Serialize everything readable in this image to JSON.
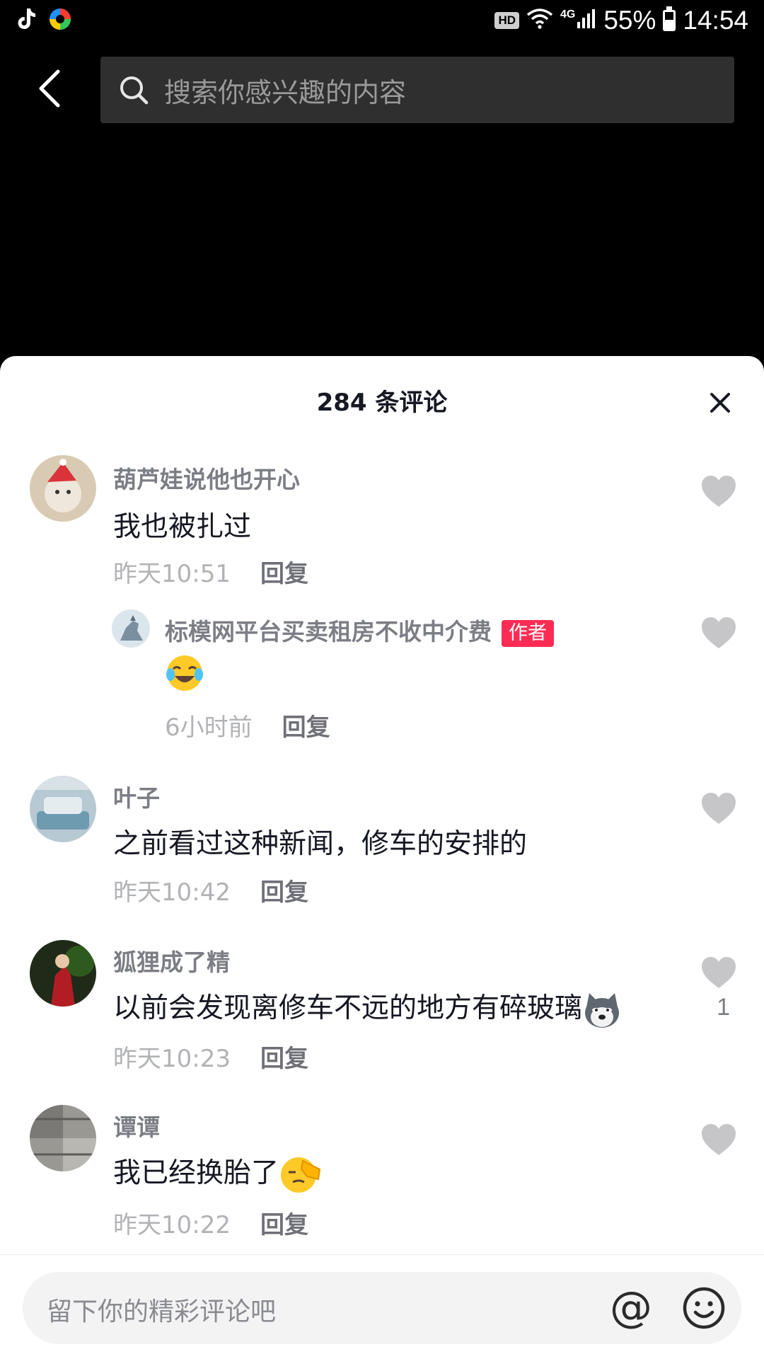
{
  "status_bar": {
    "hd": "HD",
    "network": "4G",
    "battery": "55%",
    "time": "14:54",
    "battery_level": 0.55
  },
  "search": {
    "placeholder": "搜索你感兴趣的内容"
  },
  "comments_panel": {
    "title": "284 条评论",
    "comments": [
      {
        "user": "葫芦娃说他也开心",
        "text": "我也被扎过",
        "time": "昨天10:51",
        "reply_label": "回复",
        "avatar_color": "#c9b79a"
      },
      {
        "user": "标模网平台买卖租房不收中介费",
        "badge": "作者",
        "text": "",
        "emoji": "laughing-crying-emoji",
        "time": "6小时前",
        "reply_label": "回复",
        "avatar_color": "#c7d4dc"
      },
      {
        "user": "叶子",
        "text": "之前看过这种新闻，修车的安排的",
        "time": "昨天10:42",
        "reply_label": "回复",
        "avatar_color": "#9bb6c5"
      },
      {
        "user": "狐狸成了精",
        "text": "以前会发现离修车不远的地方有碎玻璃",
        "emoji": "husky-emoji",
        "time": "昨天10:23",
        "reply_label": "回复",
        "likes": "1",
        "avatar_color": "#2a3a1f"
      },
      {
        "user": "谭谭",
        "text": "我已经换胎了",
        "emoji": "facepalm-emoji",
        "time": "昨天10:22",
        "reply_label": "回复",
        "avatar_color": "#8c8a86"
      }
    ]
  },
  "comment_input": {
    "placeholder": "留下你的精彩评论吧",
    "at_label": "@"
  },
  "colors": {
    "accent": "#fe2c55",
    "text_primary": "#161823",
    "text_secondary": "#7c7e86",
    "like_icon": "#c6c6c9"
  }
}
